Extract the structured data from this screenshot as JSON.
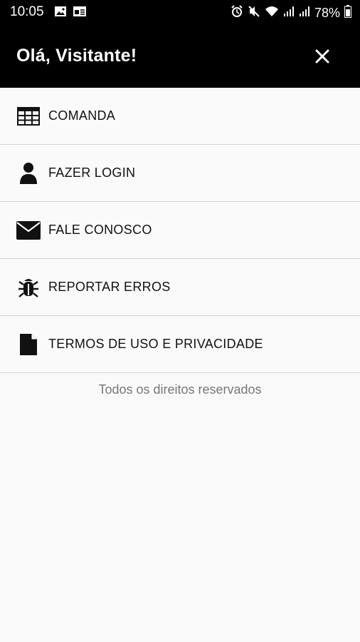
{
  "status_bar": {
    "time": "10:05",
    "battery": "78%",
    "left_icons": [
      "image-icon",
      "cast-icon"
    ],
    "right_icons": [
      "alarm-icon",
      "mute-icon",
      "wifi-icon",
      "signal-icon",
      "signal-icon",
      "battery-icon"
    ]
  },
  "header": {
    "title": "Olá, Visitante!",
    "close_icon": "close-icon",
    "background": "#000000"
  },
  "menu": {
    "items": [
      {
        "label": "COMANDA",
        "icon": "table-icon"
      },
      {
        "label": "FAZER LOGIN",
        "icon": "user-icon"
      },
      {
        "label": "FALE CONOSCO",
        "icon": "envelope-icon"
      },
      {
        "label": "REPORTAR ERROS",
        "icon": "bug-icon"
      },
      {
        "label": "TERMOS DE USO E PRIVACIDADE",
        "icon": "file-icon"
      }
    ]
  },
  "footer": {
    "text": "Todos os direitos reservados"
  }
}
